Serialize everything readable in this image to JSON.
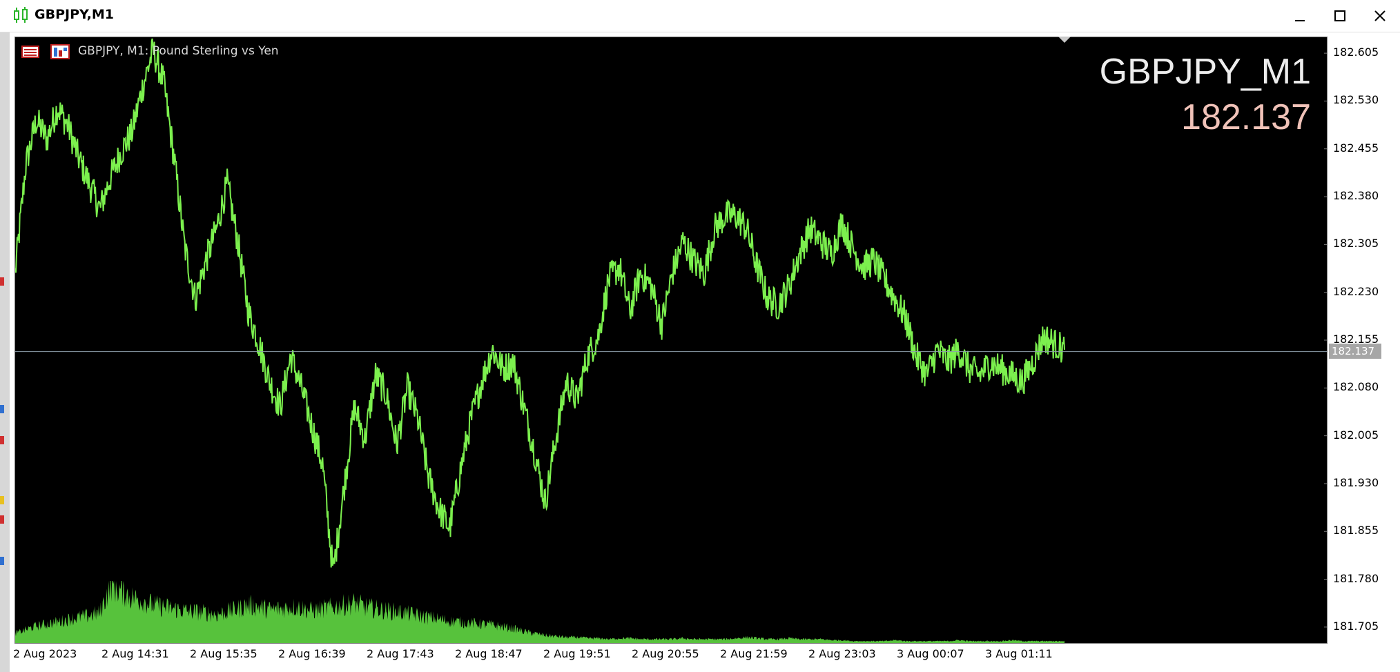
{
  "window": {
    "title": "GBPJPY,M1"
  },
  "chart": {
    "label": "GBPJPY, M1:  Pound Sterling vs Yen",
    "big_symbol": "GBPJPY_M1",
    "big_price": "182.137",
    "current_price_tag": "182.137",
    "colors": {
      "background": "#000000",
      "price_line": "#7cf04e",
      "volume": "#57c23c",
      "bid_line": "#8fa0ad",
      "big_price": "#f0c2b8"
    }
  },
  "chart_data": {
    "type": "line",
    "symbol": "GBPJPY",
    "timeframe": "M1",
    "y_ticks": [
      "182.605",
      "182.530",
      "182.455",
      "182.380",
      "182.305",
      "182.230",
      "182.155",
      "182.080",
      "182.005",
      "181.930",
      "181.855",
      "181.780",
      "181.705"
    ],
    "x_ticks": [
      "2 Aug 2023",
      "2 Aug 14:31",
      "2 Aug 15:35",
      "2 Aug 16:39",
      "2 Aug 17:43",
      "2 Aug 18:47",
      "2 Aug 19:51",
      "2 Aug 20:55",
      "2 Aug 21:59",
      "2 Aug 23:03",
      "3 Aug 00:07",
      "3 Aug 01:11"
    ],
    "ylim": [
      181.68,
      182.63
    ],
    "current_price": 182.137,
    "series": [
      {
        "values": [
          182.26,
          182.43,
          182.5,
          182.47,
          182.52,
          182.49,
          182.44,
          182.4,
          182.36,
          182.41,
          182.45,
          182.48,
          182.55,
          182.61,
          182.56,
          182.44,
          182.3,
          182.22,
          182.28,
          182.33,
          182.4,
          182.31,
          182.2,
          182.15,
          182.09,
          182.05,
          182.13,
          182.08,
          182.02,
          181.96,
          181.79,
          181.92,
          182.05,
          182.0,
          182.1,
          182.07,
          181.99,
          182.08,
          182.03,
          181.94,
          181.89,
          181.86,
          181.95,
          182.03,
          182.09,
          182.14,
          182.11,
          182.12,
          182.05,
          181.98,
          181.9,
          182.0,
          182.09,
          182.06,
          182.13,
          182.16,
          182.25,
          182.27,
          182.2,
          182.26,
          182.24,
          182.18,
          182.26,
          182.31,
          182.28,
          182.26,
          182.33,
          182.35,
          182.35,
          182.33,
          182.27,
          182.22,
          182.21,
          182.24,
          182.29,
          182.33,
          182.31,
          182.29,
          182.34,
          182.3,
          182.27,
          182.28,
          182.25,
          182.22,
          182.19,
          182.13,
          182.1,
          182.14,
          182.12,
          182.14,
          182.11,
          182.1,
          182.12,
          182.11,
          182.1,
          182.09,
          182.12,
          182.16,
          182.15,
          182.14
        ]
      }
    ],
    "volume": {
      "values": [
        0.1,
        0.14,
        0.18,
        0.2,
        0.22,
        0.25,
        0.27,
        0.29,
        0.32,
        0.62,
        0.55,
        0.48,
        0.45,
        0.4,
        0.38,
        0.36,
        0.34,
        0.33,
        0.32,
        0.3,
        0.33,
        0.36,
        0.4,
        0.38,
        0.35,
        0.36,
        0.38,
        0.37,
        0.34,
        0.36,
        0.38,
        0.4,
        0.42,
        0.38,
        0.36,
        0.34,
        0.33,
        0.31,
        0.29,
        0.27,
        0.25,
        0.23,
        0.22,
        0.21,
        0.2,
        0.19,
        0.17,
        0.15,
        0.12,
        0.1,
        0.08,
        0.07,
        0.06,
        0.06,
        0.05,
        0.05,
        0.04,
        0.05,
        0.05,
        0.04,
        0.04,
        0.04,
        0.04,
        0.05,
        0.04,
        0.04,
        0.04,
        0.04,
        0.05,
        0.06,
        0.05,
        0.04,
        0.04,
        0.05,
        0.04,
        0.04,
        0.04,
        0.03,
        0.03,
        0.02,
        0.02,
        0.02,
        0.02,
        0.03,
        0.02,
        0.02,
        0.02,
        0.02,
        0.02,
        0.03,
        0.02,
        0.02,
        0.02,
        0.02,
        0.03,
        0.02,
        0.02,
        0.02,
        0.02,
        0.02
      ]
    }
  }
}
